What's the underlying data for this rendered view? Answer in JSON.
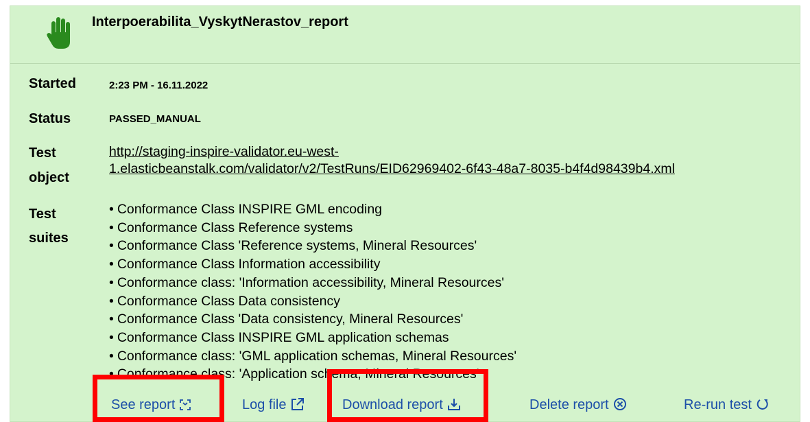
{
  "header": {
    "title": "Interpoerabilita_VyskytNerastov_report",
    "status_icon": "hand-stop-icon",
    "icon_color": "#2a8a1e"
  },
  "details": {
    "started_label": "Started",
    "started_value": "2:23 PM - 16.11.2022",
    "status_label": "Status",
    "status_value": "PASSED_MANUAL",
    "test_object_label_1": "Test",
    "test_object_label_2": "object",
    "test_object_link_1": "http://staging-inspire-validator.eu-west-",
    "test_object_link_2": "1.elasticbeanstalk.com/validator/v2/TestRuns/EID62969402-6f43-48a7-8035-b4f4d98439b4.xml",
    "test_suites_label_1": "Test",
    "test_suites_label_2": "suites",
    "test_suites": [
      "Conformance Class INSPIRE GML encoding",
      "Conformance Class Reference systems",
      "Conformance Class 'Reference systems, Mineral Resources'",
      "Conformance Class Information accessibility",
      "Conformance class: 'Information accessibility, Mineral Resources'",
      "Conformance Class Data consistency",
      "Conformance Class 'Data consistency, Mineral Resources'",
      "Conformance Class INSPIRE GML application schemas",
      "Conformance class: 'GML application schemas, Mineral Resources'",
      "Conformance class: 'Application schema, Mineral Resources'"
    ]
  },
  "actions": {
    "see_report": "See report",
    "log_file": "Log file",
    "download_report": "Download report",
    "delete_report": "Delete report",
    "rerun_test": "Re-run test"
  },
  "colors": {
    "panel_background": "#d4f3cc",
    "link_blue": "#1c4fa8",
    "highlight_red": "#ff0000"
  }
}
